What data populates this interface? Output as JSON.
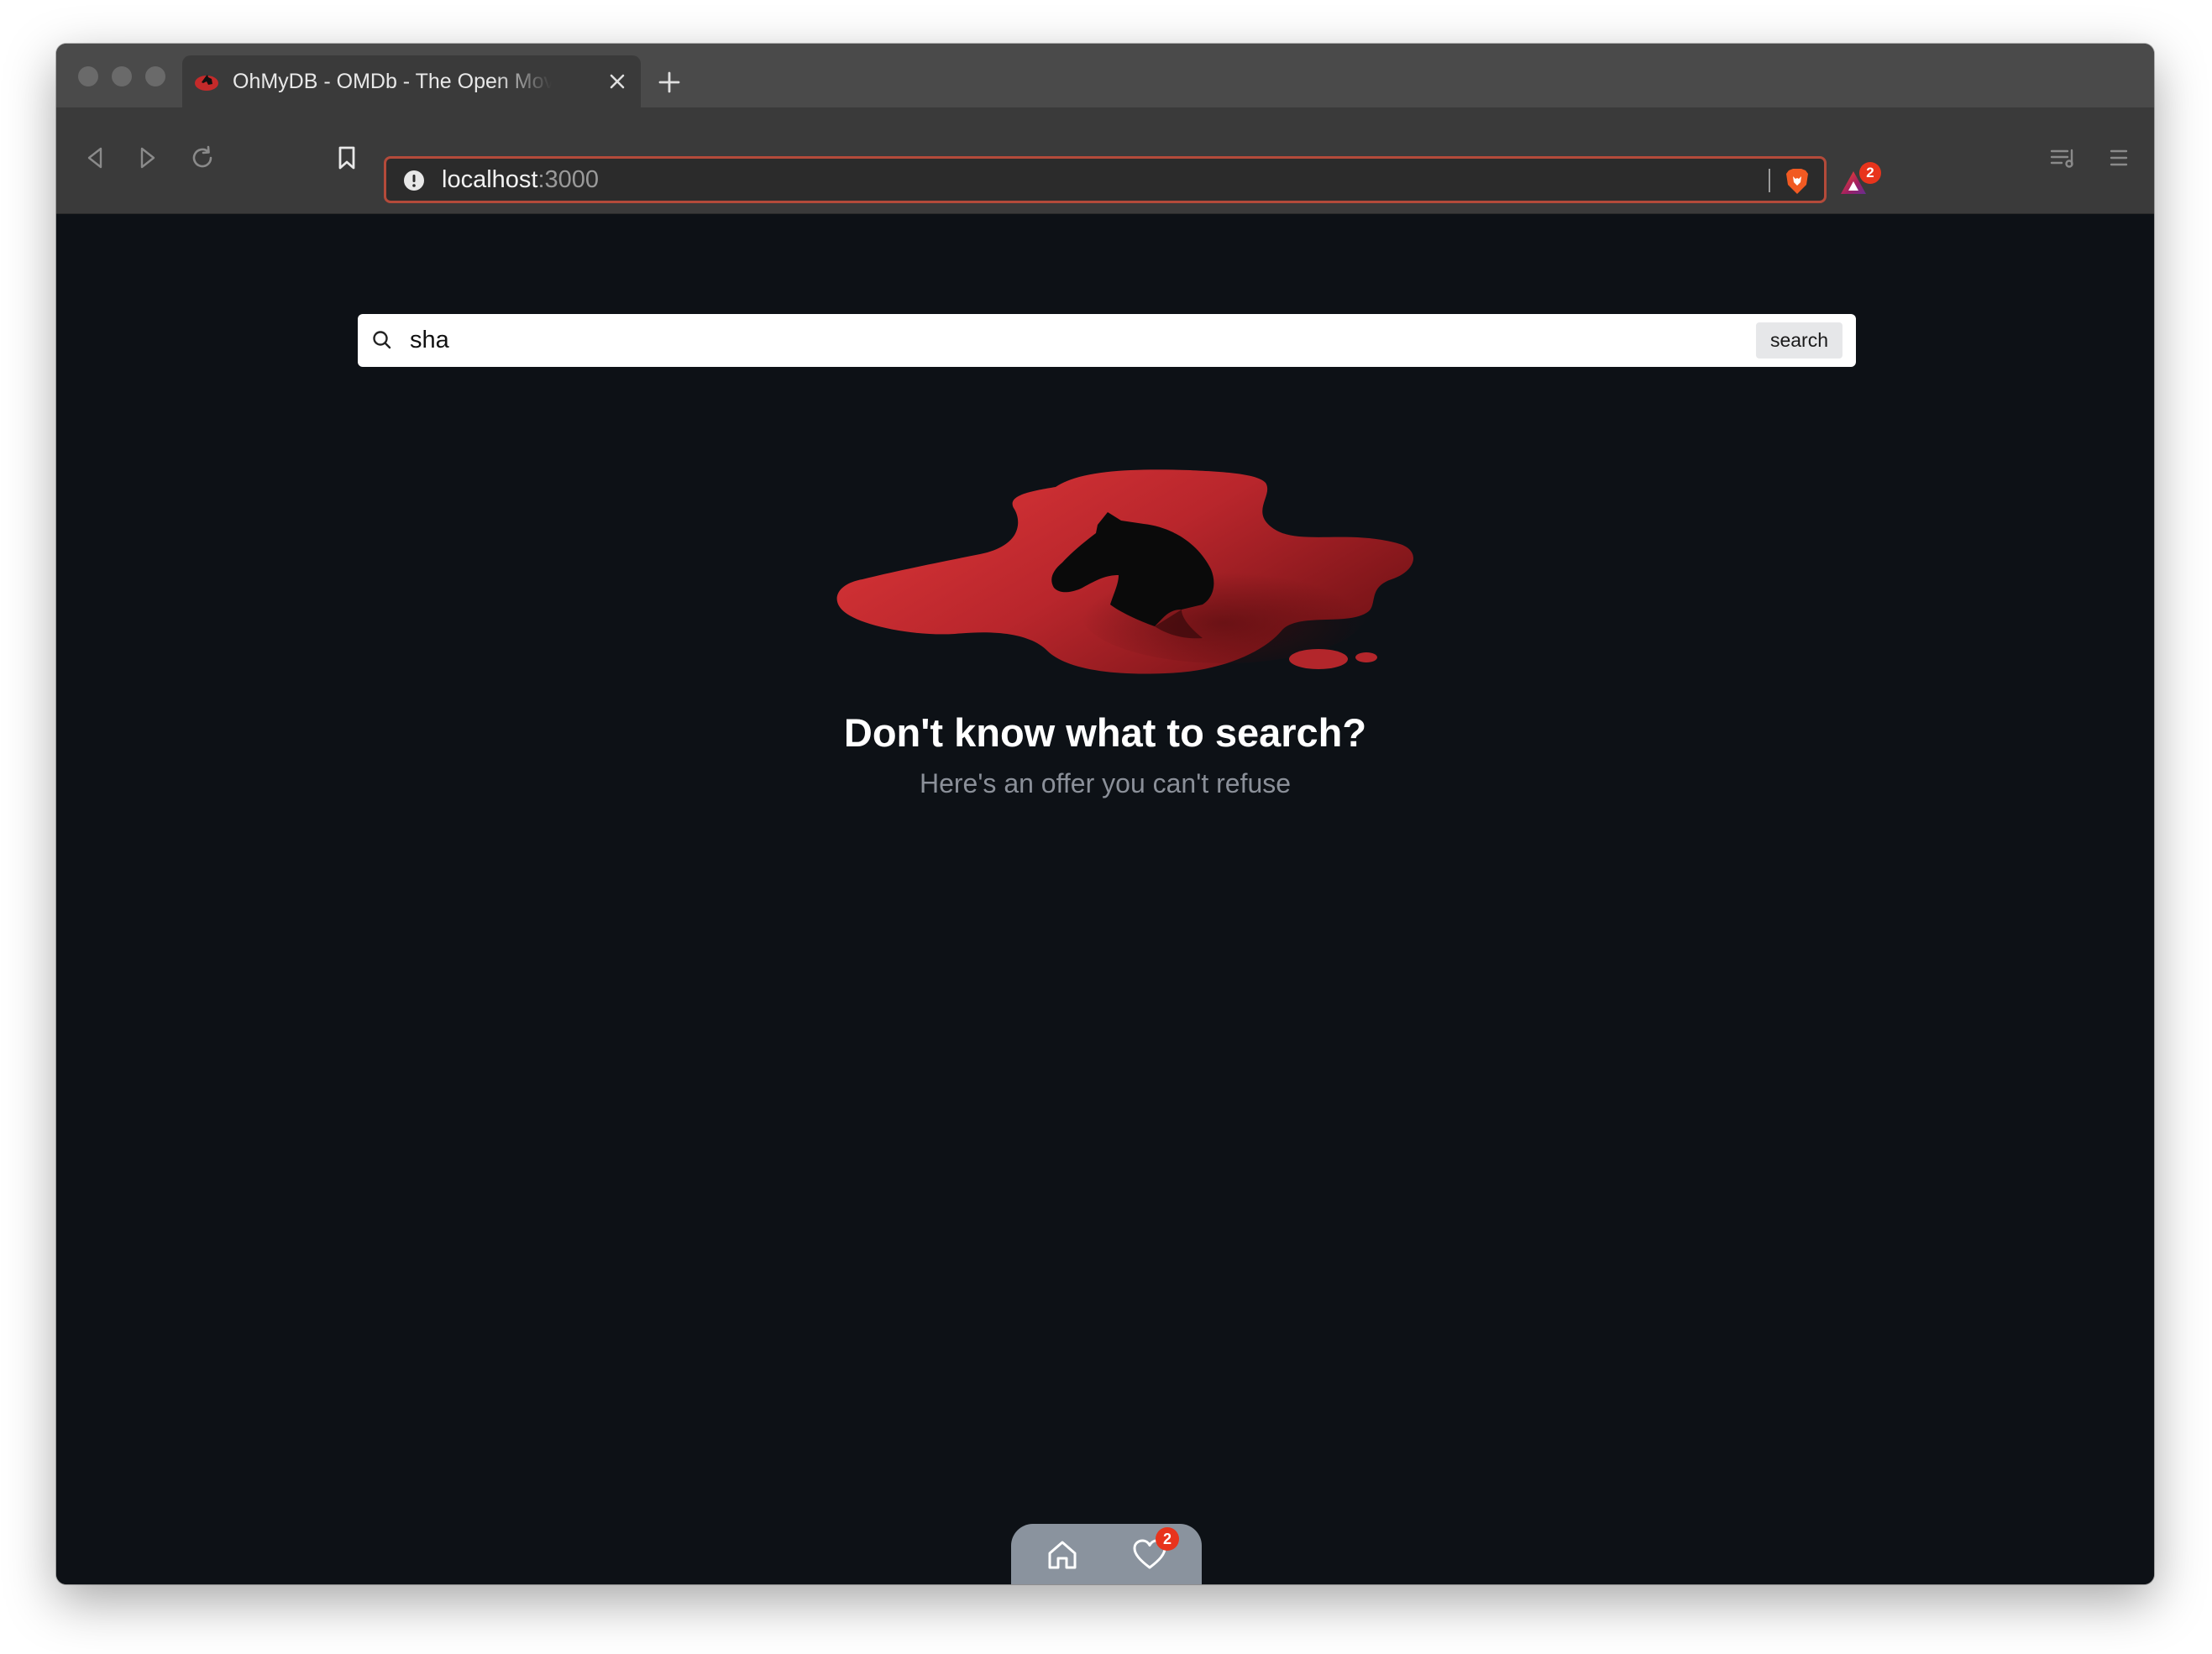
{
  "browser": {
    "tab": {
      "title": "OhMyDB - OMDb - The Open Movie Database",
      "favicon": "blood-horse-icon"
    },
    "address": {
      "host": "localhost",
      "port": ":3000"
    },
    "rewards_badge": "2",
    "colors": {
      "chrome": "#3a3a3a",
      "urlbar_border": "#b44a3a",
      "brave_orange": "#f15a22"
    }
  },
  "search": {
    "value": "sha",
    "button_label": "search"
  },
  "empty_state": {
    "illustration": "blood-pool-horse-head",
    "headline": "Don't know what to search?",
    "subline": "Here's an offer you can't refuse"
  },
  "bottom_nav": {
    "items": [
      {
        "icon": "home-icon"
      },
      {
        "icon": "heart-icon",
        "badge": "2"
      }
    ]
  },
  "colors": {
    "page_background": "#0d1116",
    "accent_red": "#c0282a",
    "nav_background": "#8a939e",
    "badge": "#e8341c"
  }
}
